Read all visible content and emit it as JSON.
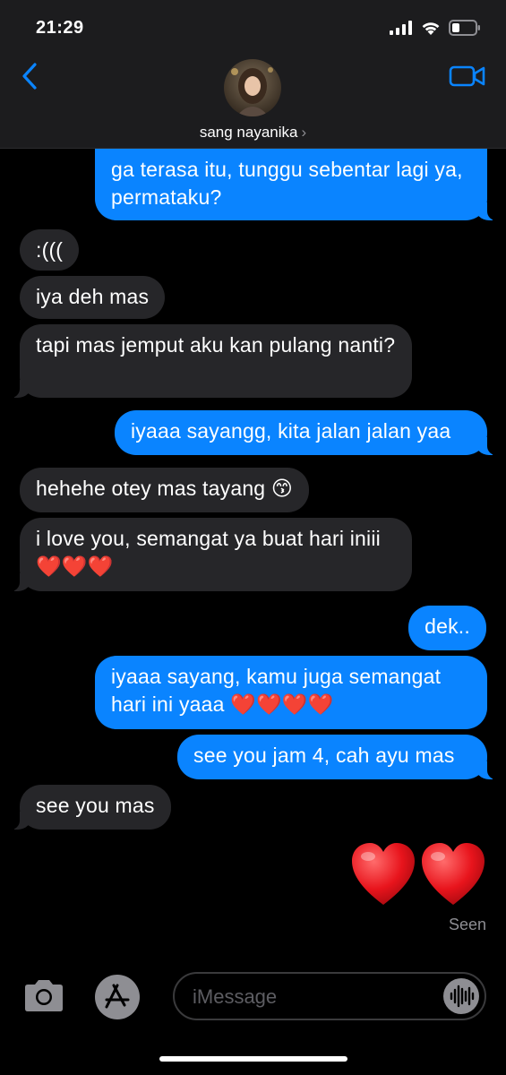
{
  "status": {
    "time": "21:29"
  },
  "contact": {
    "name": "sang nayanika",
    "chevron": "›"
  },
  "messages": [
    {
      "dir": "out",
      "text": "ga terasa itu, tunggu sebentar lagi ya, permataku?"
    },
    {
      "dir": "in",
      "text": ":((("
    },
    {
      "dir": "in",
      "text": "iya deh mas"
    },
    {
      "dir": "in",
      "text": "tapi mas jemput aku kan pulang nanti?"
    },
    {
      "dir": "out",
      "text": "iyaaa sayangg, kita jalan jalan yaa"
    },
    {
      "dir": "in",
      "text": "hehehe otey mas tayang 😙"
    },
    {
      "dir": "in",
      "text": "i love you, semangat ya buat hari iniii ❤️❤️❤️"
    },
    {
      "dir": "out",
      "text": "dek.."
    },
    {
      "dir": "out",
      "text": "iyaaa sayang, kamu juga semangat hari ini yaaa ❤️❤️❤️❤️"
    },
    {
      "dir": "out",
      "text": "see you jam 4, cah ayu mas"
    },
    {
      "dir": "in",
      "text": "see you mas"
    },
    {
      "dir": "out",
      "text": "❤️❤️"
    }
  ],
  "receipt": "Seen",
  "composer": {
    "placeholder": "iMessage"
  },
  "colors": {
    "outgoing": "#0a84ff",
    "incoming": "#262629",
    "header": "#1c1c1e"
  },
  "icons": [
    "signal-icon",
    "wifi-icon",
    "battery-icon",
    "back-chevron-icon",
    "video-call-icon",
    "camera-icon",
    "app-store-icon",
    "audio-waveform-icon",
    "heart-icon"
  ]
}
